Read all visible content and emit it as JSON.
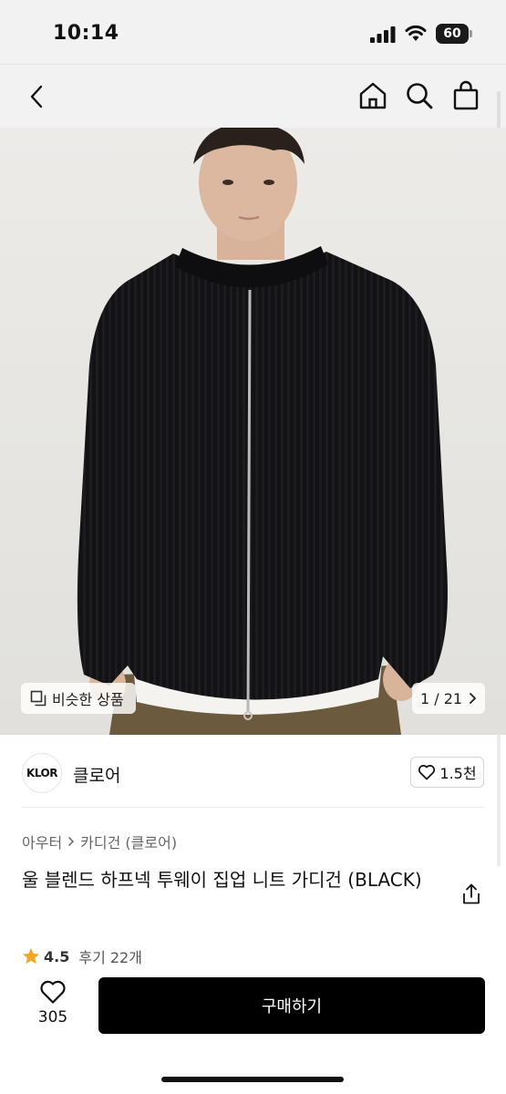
{
  "status": {
    "time": "10:14",
    "battery": "60"
  },
  "nav": {
    "back_icon": "chevron-left-icon",
    "home_icon": "home-icon",
    "search_icon": "search-icon",
    "bag_icon": "shopping-bag-icon"
  },
  "gallery": {
    "similar_label": "비슷한 상품",
    "page_indicator": "1 / 21",
    "image_subject": "man wearing black ribbed zip-up knit cardigan over white tee"
  },
  "brand": {
    "logo_text": "KLOR",
    "name": "클로어",
    "likes": "1.5천"
  },
  "breadcrumb": {
    "category": "아우터",
    "subcategory": "카디건 (클로어)"
  },
  "product": {
    "title": "울 블렌드 하프넥 투웨이 집업 니트 가디건 (BLACK)",
    "rating": "4.5",
    "reviews": "후기 22개"
  },
  "bottom": {
    "wish_count": "305",
    "buy_label": "구매하기"
  },
  "colors": {
    "accent": "#000000",
    "star": "#f5a623",
    "hero_bg": "#e8e7e4"
  }
}
